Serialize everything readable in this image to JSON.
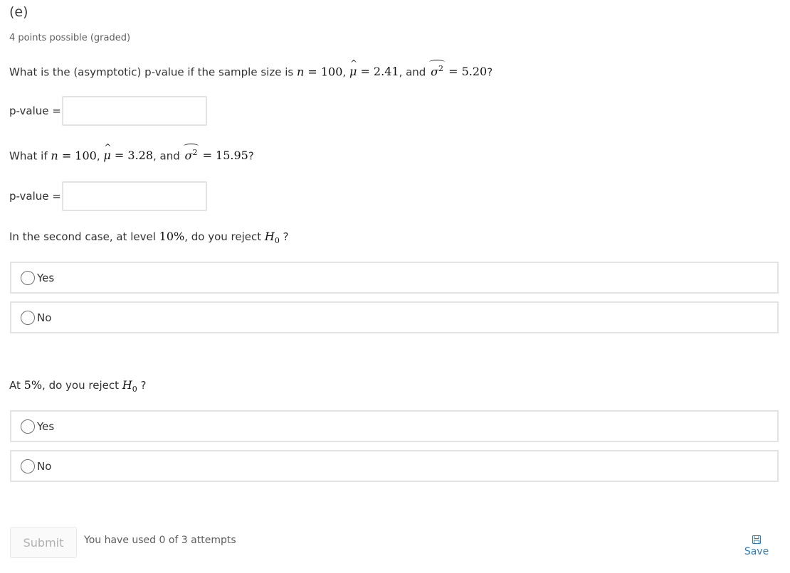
{
  "problem": {
    "title": "(e)",
    "points": "4 points possible (graded)"
  },
  "q1": {
    "text_before": "What is the (asymptotic) p-value if the sample size is ",
    "n_label": "n",
    "n_value": "= 100",
    "mu_label": "μ",
    "mu_value": "= 2.41",
    "and": ", and ",
    "sigma_label": "σ",
    "sigma_sup": "2",
    "sigma_value": "= 5.20",
    "end": "?",
    "input_label": "p-value =",
    "input_value": ""
  },
  "q2": {
    "text_before": "What if ",
    "n_label": "n",
    "n_value": "= 100",
    "mu_label": "μ",
    "mu_value": "= 3.28",
    "and": ", and ",
    "sigma_label": "σ",
    "sigma_sup": "2",
    "sigma_value": "= 15.95",
    "end": "?",
    "input_label": "p-value =",
    "input_value": ""
  },
  "q3": {
    "text_before": "In the second case, at level ",
    "level": "10%",
    "text_after": ", do you reject ",
    "h": "H",
    "h_sub": "0",
    "end": " ?",
    "choices": [
      "Yes",
      "No"
    ]
  },
  "q4": {
    "text_before": "At ",
    "level": "5%",
    "text_after": ", do you reject ",
    "h": "H",
    "h_sub": "0",
    "end": " ?",
    "choices": [
      "Yes",
      "No"
    ]
  },
  "footer": {
    "submit_label": "Submit",
    "attempts_text": "You have used 0 of 3 attempts",
    "save_label": "Save",
    "save_icon": "floppy-disk-icon",
    "accent_color": "#2e7bb8"
  }
}
